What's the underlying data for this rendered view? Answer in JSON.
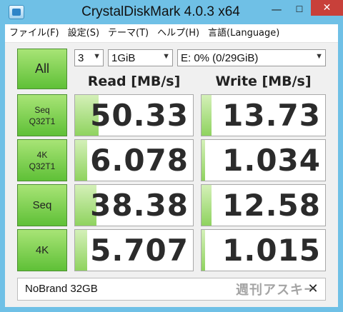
{
  "window": {
    "title": "CrystalDiskMark 4.0.3 x64",
    "minimize": "—",
    "maximize": "☐",
    "close": "✕"
  },
  "menu": [
    "ファイル(F)",
    "設定(S)",
    "テーマ(T)",
    "ヘルプ(H)",
    "言語(Language)"
  ],
  "controls": {
    "all_label": "All",
    "count": "3",
    "size": "1GiB",
    "drive": "E: 0% (0/29GiB)"
  },
  "headers": {
    "read": "Read [MB/s]",
    "write": "Write [MB/s]"
  },
  "tests": [
    {
      "line1": "Seq",
      "line2": "Q32T1",
      "read": "50.33",
      "write": "13.73",
      "read_fraction": 0.2,
      "write_fraction": 0.08
    },
    {
      "line1": "4K",
      "line2": "Q32T1",
      "read": "6.078",
      "write": "1.034",
      "read_fraction": 0.1,
      "write_fraction": 0.03
    },
    {
      "line1": "Seq",
      "line2": "",
      "read": "38.38",
      "write": "12.58",
      "read_fraction": 0.18,
      "write_fraction": 0.08
    },
    {
      "line1": "4K",
      "line2": "",
      "read": "5.707",
      "write": "1.015",
      "read_fraction": 0.1,
      "write_fraction": 0.03
    }
  ],
  "comment": "NoBrand 32GB",
  "clear_label": "✕",
  "watermark": "週刊アスキー",
  "colors": {
    "titlebar": "#6fc0e6",
    "button_green": "#6fcb45",
    "bar_green": "#8fd35f",
    "close_red": "#c8403a"
  }
}
